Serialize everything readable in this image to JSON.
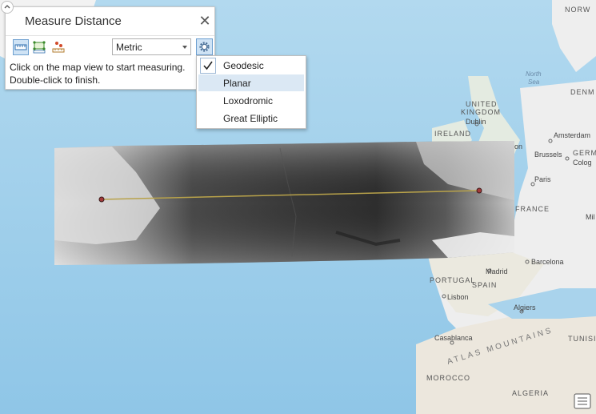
{
  "panel": {
    "title": "Measure Distance",
    "close_symbol": "✕",
    "unit_value": "Metric",
    "instruction_line1": "Click on the map view to start measuring.",
    "instruction_line2": "Double-click to finish."
  },
  "menu": {
    "items": [
      {
        "label": "Geodesic",
        "checked": true
      },
      {
        "label": "Planar",
        "checked": false,
        "highlighted": true
      },
      {
        "label": "Loxodromic",
        "checked": false
      },
      {
        "label": "Great Elliptic",
        "checked": false
      }
    ]
  },
  "map_labels": {
    "norway": "NORW",
    "north_sea_1": "North",
    "north_sea_2": "Sea",
    "denmark": "DENM",
    "uk_1": "UNITED",
    "uk_2": "KINGDOM",
    "dublin": "Dublin",
    "ireland": "IRELAND",
    "amsterdam": "Amsterdam",
    "brussels": "Brussels",
    "germany": "GERM",
    "cologne": "Colog",
    "paris": "Paris",
    "france": "FRANCE",
    "milan": "Mil",
    "barcelona": "Barcelona",
    "madrid": "Madrid",
    "portugal": "PORTUGAL",
    "spain": "SPAIN",
    "lisbon": "Lisbon",
    "algiers": "Algiers",
    "tunisia": "TUNISI",
    "casablanca": "Casablanca",
    "atlas": "ATLAS MOUNTAINS",
    "morocco": "MOROCCO",
    "algeria": "ALGERIA",
    "london": "on"
  },
  "colors": {
    "ocean": "#a9d3ec",
    "land": "#eeeeee",
    "measure_line": "#b8a24a",
    "vertex": "#a33a3a"
  }
}
